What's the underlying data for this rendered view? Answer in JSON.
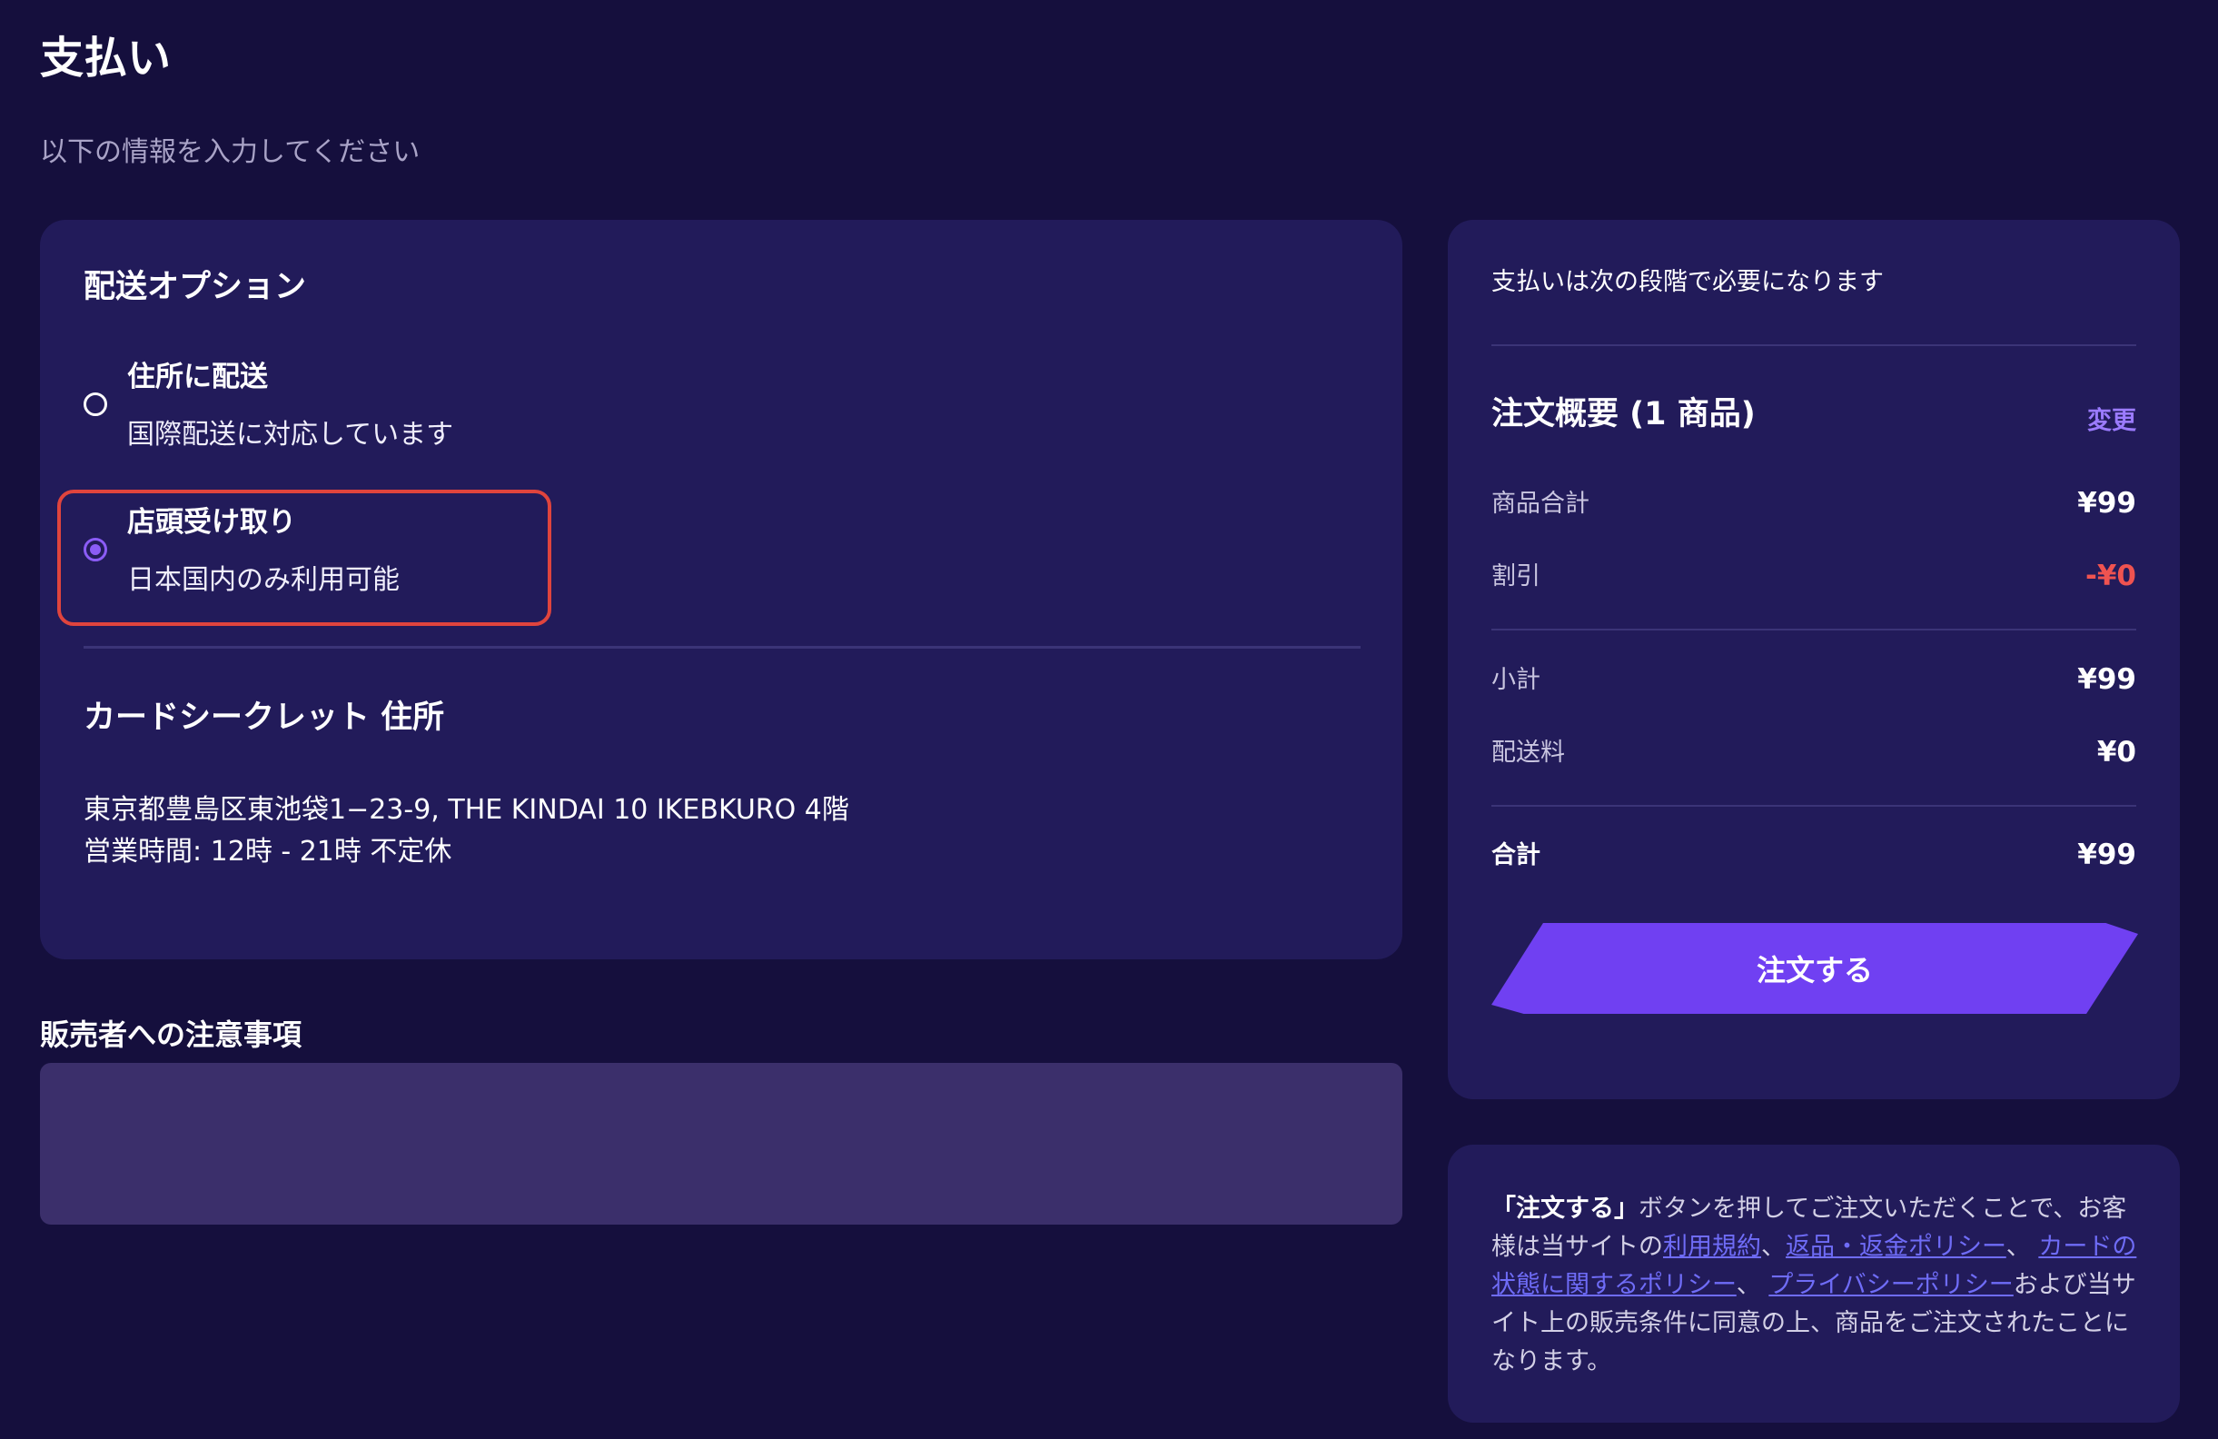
{
  "page": {
    "title": "支払い",
    "subtitle": "以下の情報を入力してください"
  },
  "delivery": {
    "heading": "配送オプション",
    "options": [
      {
        "title": "住所に配送",
        "description": "国際配送に対応しています",
        "selected": false
      },
      {
        "title": "店頭受け取り",
        "description": "日本国内のみ利用可能",
        "selected": true
      }
    ],
    "store": {
      "heading": "カードシークレット 住所",
      "address": "東京都豊島区東池袋1−23-9, THE KINDAI 10 IKEBKURO 4階",
      "hours": "営業時間: 12時 - 21時 不定休"
    }
  },
  "notes": {
    "label": "販売者への注意事項",
    "value": ""
  },
  "summary": {
    "note": "支払いは次の段階で必要になります",
    "title": "注文概要 (1 商品)",
    "change_label": "変更",
    "items_total_label": "商品合計",
    "items_total": "¥99",
    "discount_label": "割引",
    "discount": "-¥0",
    "subtotal_label": "小計",
    "subtotal": "¥99",
    "shipping_label": "配送料",
    "shipping": "¥0",
    "total_label": "合計",
    "total": "¥99",
    "order_button": "注文する"
  },
  "terms": {
    "button_ref": "「注文する」",
    "text1": "ボタンを押してご注文いただくことで、お客様は当サイトの",
    "link_terms": "利用規約",
    "sep1": "、",
    "link_refund": "返品・返金ポリシー",
    "sep2": "、 ",
    "link_card": "カードの状態に関するポリシー",
    "sep3": "、 ",
    "link_privacy": "プライバシーポリシー",
    "text2": "および当サイト上の販売条件に同意の上、商品をご注文されたことになります。"
  },
  "colors": {
    "background": "#150f3d",
    "card": "#221b5a",
    "accent": "#7040f2",
    "highlight": "#e0443d",
    "discount": "#ef5350",
    "link": "#6f6cf7"
  }
}
